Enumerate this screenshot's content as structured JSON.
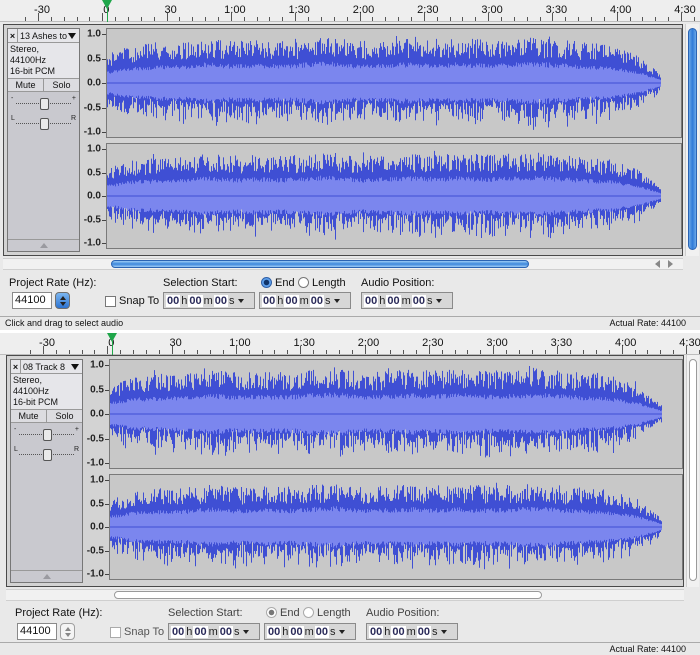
{
  "ruler": {
    "labels": [
      "-30",
      "0",
      "30",
      "1:00",
      "1:30",
      "2:00",
      "2:30",
      "3:00",
      "3:30",
      "4:00",
      "4:30"
    ]
  },
  "window_top": {
    "track": {
      "name": "13 Ashes to",
      "format": "Stereo, 44100Hz",
      "bits": "16-bit PCM",
      "mute": "Mute",
      "solo": "Solo",
      "pan_left": "L",
      "pan_right": "R",
      "gain_minus": "-",
      "gain_plus": "+"
    },
    "axis": [
      "1.0",
      "0.5",
      "0.0",
      "-0.5",
      "-1.0"
    ],
    "toolbar": {
      "project_rate_label": "Project Rate (Hz):",
      "project_rate": "44100",
      "snap_to": "Snap To",
      "selection_start_label": "Selection Start:",
      "end_label": "End",
      "length_label": "Length",
      "audio_position_label": "Audio Position:",
      "time": {
        "h": "00",
        "hu": "h",
        "m": "00",
        "mu": "m",
        "s": "00",
        "su": "s"
      }
    },
    "status_left": "Click and drag to select audio",
    "status_right": "Actual Rate: 44100"
  },
  "window_bottom": {
    "track": {
      "name": "08 Track 8",
      "format": "Stereo, 44100Hz",
      "bits": "16-bit PCM",
      "mute": "Mute",
      "solo": "Solo",
      "pan_left": "L",
      "pan_right": "R",
      "gain_minus": "-",
      "gain_plus": "+"
    },
    "axis": [
      "1.0",
      "0.5",
      "0.0",
      "-0.5",
      "-1.0"
    ],
    "toolbar": {
      "project_rate_label": "Project Rate (Hz):",
      "project_rate": "44100",
      "snap_to": "Snap To",
      "selection_start_label": "Selection Start:",
      "end_label": "End",
      "length_label": "Length",
      "audio_position_label": "Audio Position:",
      "time": {
        "h": "00",
        "hu": "h",
        "m": "00",
        "mu": "m",
        "s": "00",
        "su": "s"
      }
    },
    "status_left": "",
    "status_right": "Actual Rate: 44100"
  },
  "colors": {
    "waveform": "#3f4fd4",
    "waveform_rms": "#7b86ee",
    "accent": "#2f7ad8",
    "playhead": "#1fa64a"
  },
  "waveform_envelope": {
    "peak": [
      0.62,
      0.78,
      0.86,
      0.84,
      0.92,
      0.88,
      0.9,
      0.87,
      0.92,
      0.95,
      0.88,
      0.9,
      0.93,
      0.92,
      0.94,
      0.9,
      0.92,
      0.95,
      0.9,
      0.86,
      0.8,
      0.6,
      0.18
    ],
    "rms": [
      0.22,
      0.3,
      0.32,
      0.33,
      0.38,
      0.34,
      0.36,
      0.34,
      0.38,
      0.4,
      0.34,
      0.36,
      0.38,
      0.36,
      0.38,
      0.35,
      0.37,
      0.39,
      0.36,
      0.33,
      0.3,
      0.22,
      0.06
    ]
  },
  "icons": [
    "close-icon",
    "track-menu-arrow-icon",
    "collapse-icon",
    "scroll-left-icon",
    "scroll-right-icon",
    "stepper-icon",
    "dropdown-arrow-icon"
  ]
}
